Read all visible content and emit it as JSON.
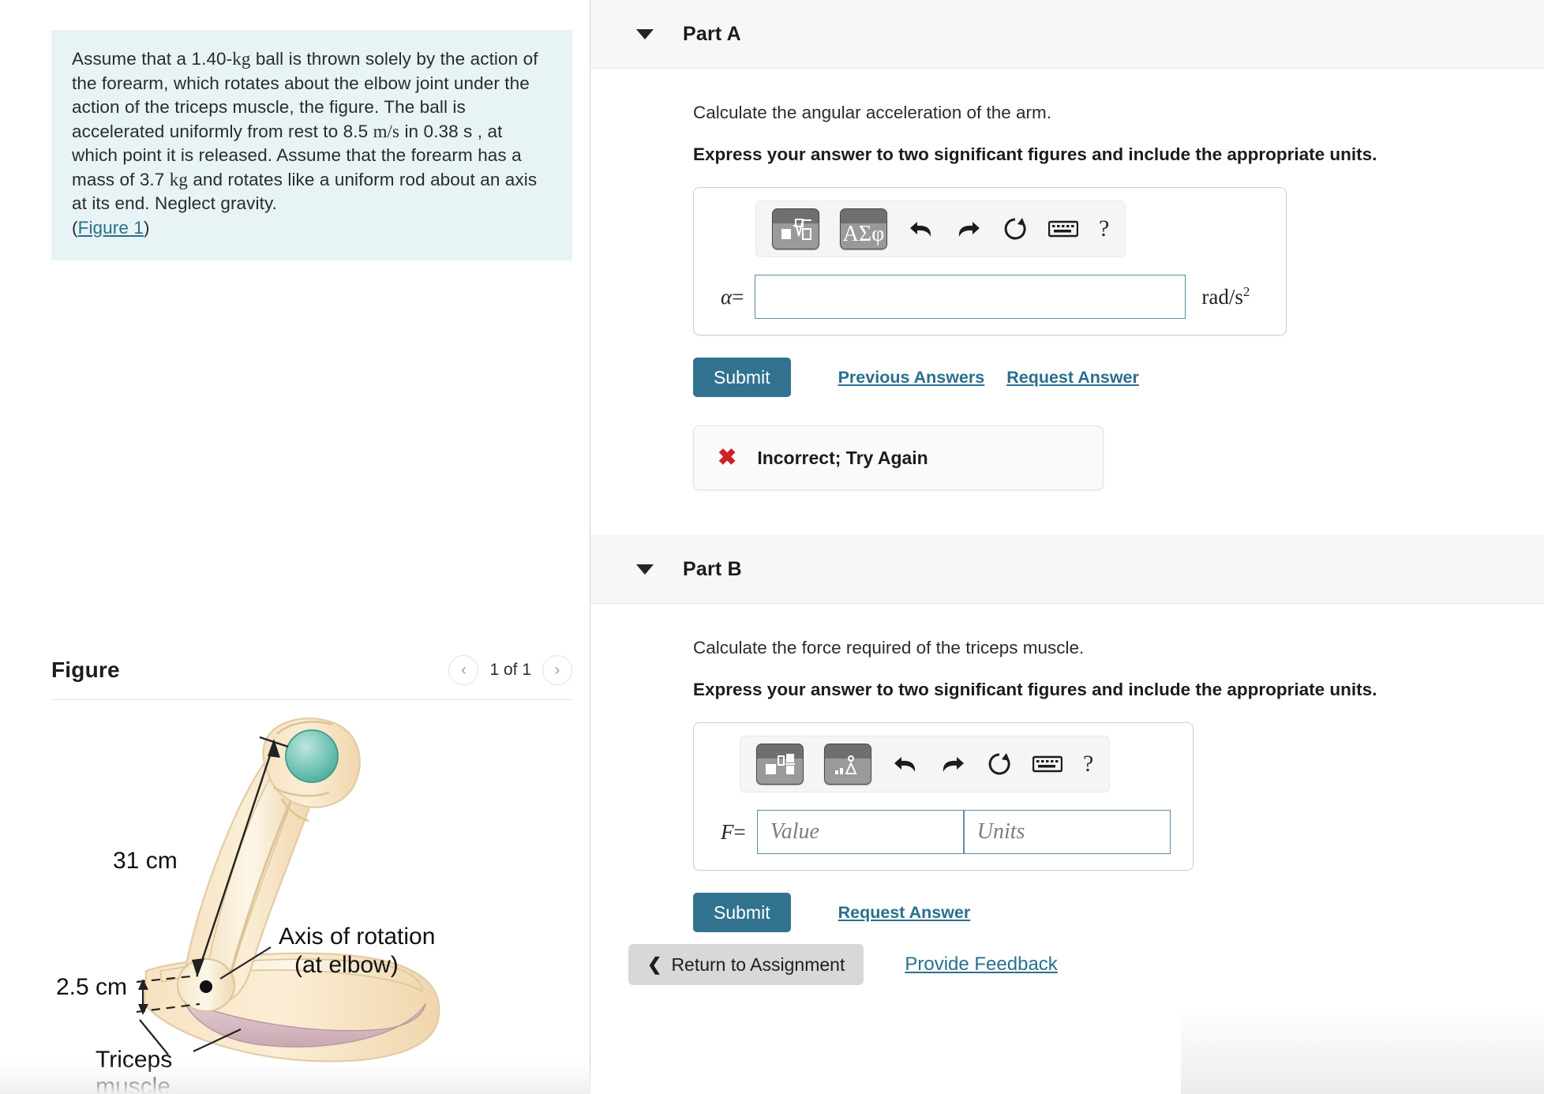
{
  "question": {
    "segments": [
      {
        "t": "Assume that a 1.40-",
        "k": "plain"
      },
      {
        "t": "kg",
        "k": "math"
      },
      {
        "t": " ball is thrown solely by the action of the forearm, which rotates about the elbow joint under the action of the triceps muscle, the figure. The ball is accelerated uniformly from rest to 8.5 ",
        "k": "plain"
      },
      {
        "t": "m/s",
        "k": "math"
      },
      {
        "t": " in 0.38 s , at which point it is released. Assume that the forearm has a mass of 3.7 ",
        "k": "plain"
      },
      {
        "t": "kg",
        "k": "math"
      },
      {
        "t": " and rotates like a uniform rod about an axis at its end. Neglect gravity.",
        "k": "plain"
      }
    ],
    "figure_link_prefix": "(",
    "figure_link": "Figure 1",
    "figure_link_suffix": ")"
  },
  "figure_panel": {
    "title": "Figure",
    "pager_label": "1 of 1",
    "prev_icon": "chevron-left-icon",
    "next_icon": "chevron-right-icon",
    "labels": {
      "length": "31 cm",
      "moment_arm": "2.5 cm",
      "axis_line1": "Axis of rotation",
      "axis_line2": "(at elbow)",
      "triceps_line1": "Triceps",
      "triceps_line2": "muscle"
    }
  },
  "part_a": {
    "title": "Part A",
    "prompt": "Calculate the angular acceleration of the arm.",
    "instruction": "Express your answer to two significant figures and include the appropriate units.",
    "toolbar": {
      "template_icon": "math-template-icon",
      "greek_label": "ΑΣφ",
      "undo_icon": "undo-icon",
      "redo_icon": "redo-icon",
      "reset_icon": "reset-icon",
      "keyboard_icon": "keyboard-icon",
      "help_label": "?"
    },
    "variable": "α",
    "equals": "=",
    "value": "",
    "placeholder": "",
    "unit_base": "rad/s",
    "unit_exp": "2",
    "submit_label": "Submit",
    "previous_answers_label": "Previous Answers",
    "request_answer_label": "Request Answer",
    "feedback": {
      "icon": "x-mark-icon",
      "text": "Incorrect; Try Again"
    }
  },
  "part_b": {
    "title": "Part B",
    "prompt": "Calculate the force required of the triceps muscle.",
    "instruction": "Express your answer to two significant figures and include the appropriate units.",
    "toolbar": {
      "template_icon": "layout-template-icon",
      "units_icon": "units-template-icon",
      "undo_icon": "undo-icon",
      "redo_icon": "redo-icon",
      "reset_icon": "reset-icon",
      "keyboard_icon": "keyboard-icon",
      "help_label": "?"
    },
    "variable": "F",
    "equals": "=",
    "value_placeholder": "Value",
    "units_placeholder": "Units",
    "value": "",
    "units": "",
    "submit_label": "Submit",
    "request_answer_label": "Request Answer"
  },
  "footer": {
    "return_label": "Return to Assignment",
    "return_icon": "chevron-left-icon",
    "provide_feedback_label": "Provide Feedback"
  },
  "colors": {
    "accent_link": "#2a6f8e",
    "submit_bg": "#31738f",
    "question_bg": "#e7f3f4",
    "error_red": "#cf2026",
    "part_header_bg": "#f7f7f7"
  }
}
